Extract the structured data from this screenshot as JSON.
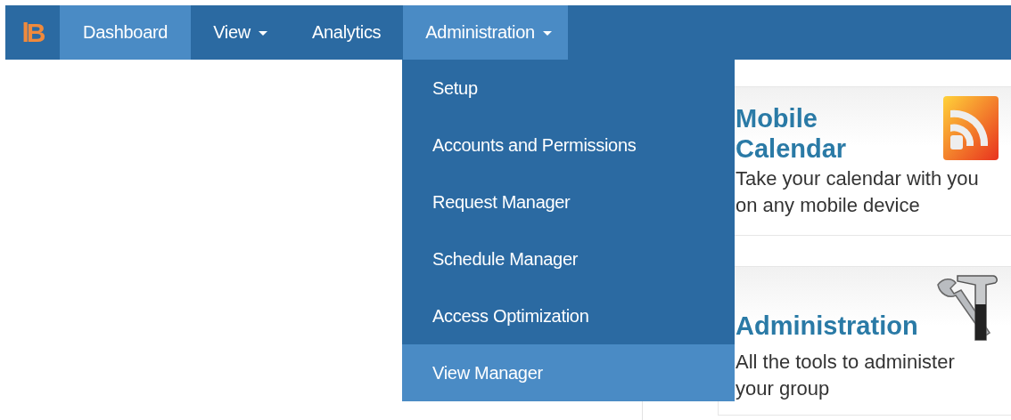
{
  "nav": {
    "logo": "lB",
    "items": [
      {
        "kind": "link",
        "label": "Dashboard",
        "selected": true
      },
      {
        "kind": "menu",
        "label": "View",
        "expanded": false
      },
      {
        "kind": "link",
        "label": "Analytics",
        "selected": false
      },
      {
        "kind": "menu",
        "label": "Administration",
        "expanded": true
      }
    ]
  },
  "menu": {
    "items": [
      {
        "label": "Setup",
        "selected": false
      },
      {
        "label": "Accounts and Permissions",
        "selected": false
      },
      {
        "label": "Request Manager",
        "selected": false
      },
      {
        "label": "Schedule Manager",
        "selected": false
      },
      {
        "label": "Access Optimization",
        "selected": false
      },
      {
        "label": "View Manager",
        "selected": true
      }
    ]
  },
  "cards": [
    {
      "kind": "feed",
      "title": "Mobile Calendar",
      "text": "Take your calendar with you on any mobile device"
    },
    {
      "kind": "tools",
      "title": "Administration",
      "text": "All the tools to administer your group"
    }
  ]
}
